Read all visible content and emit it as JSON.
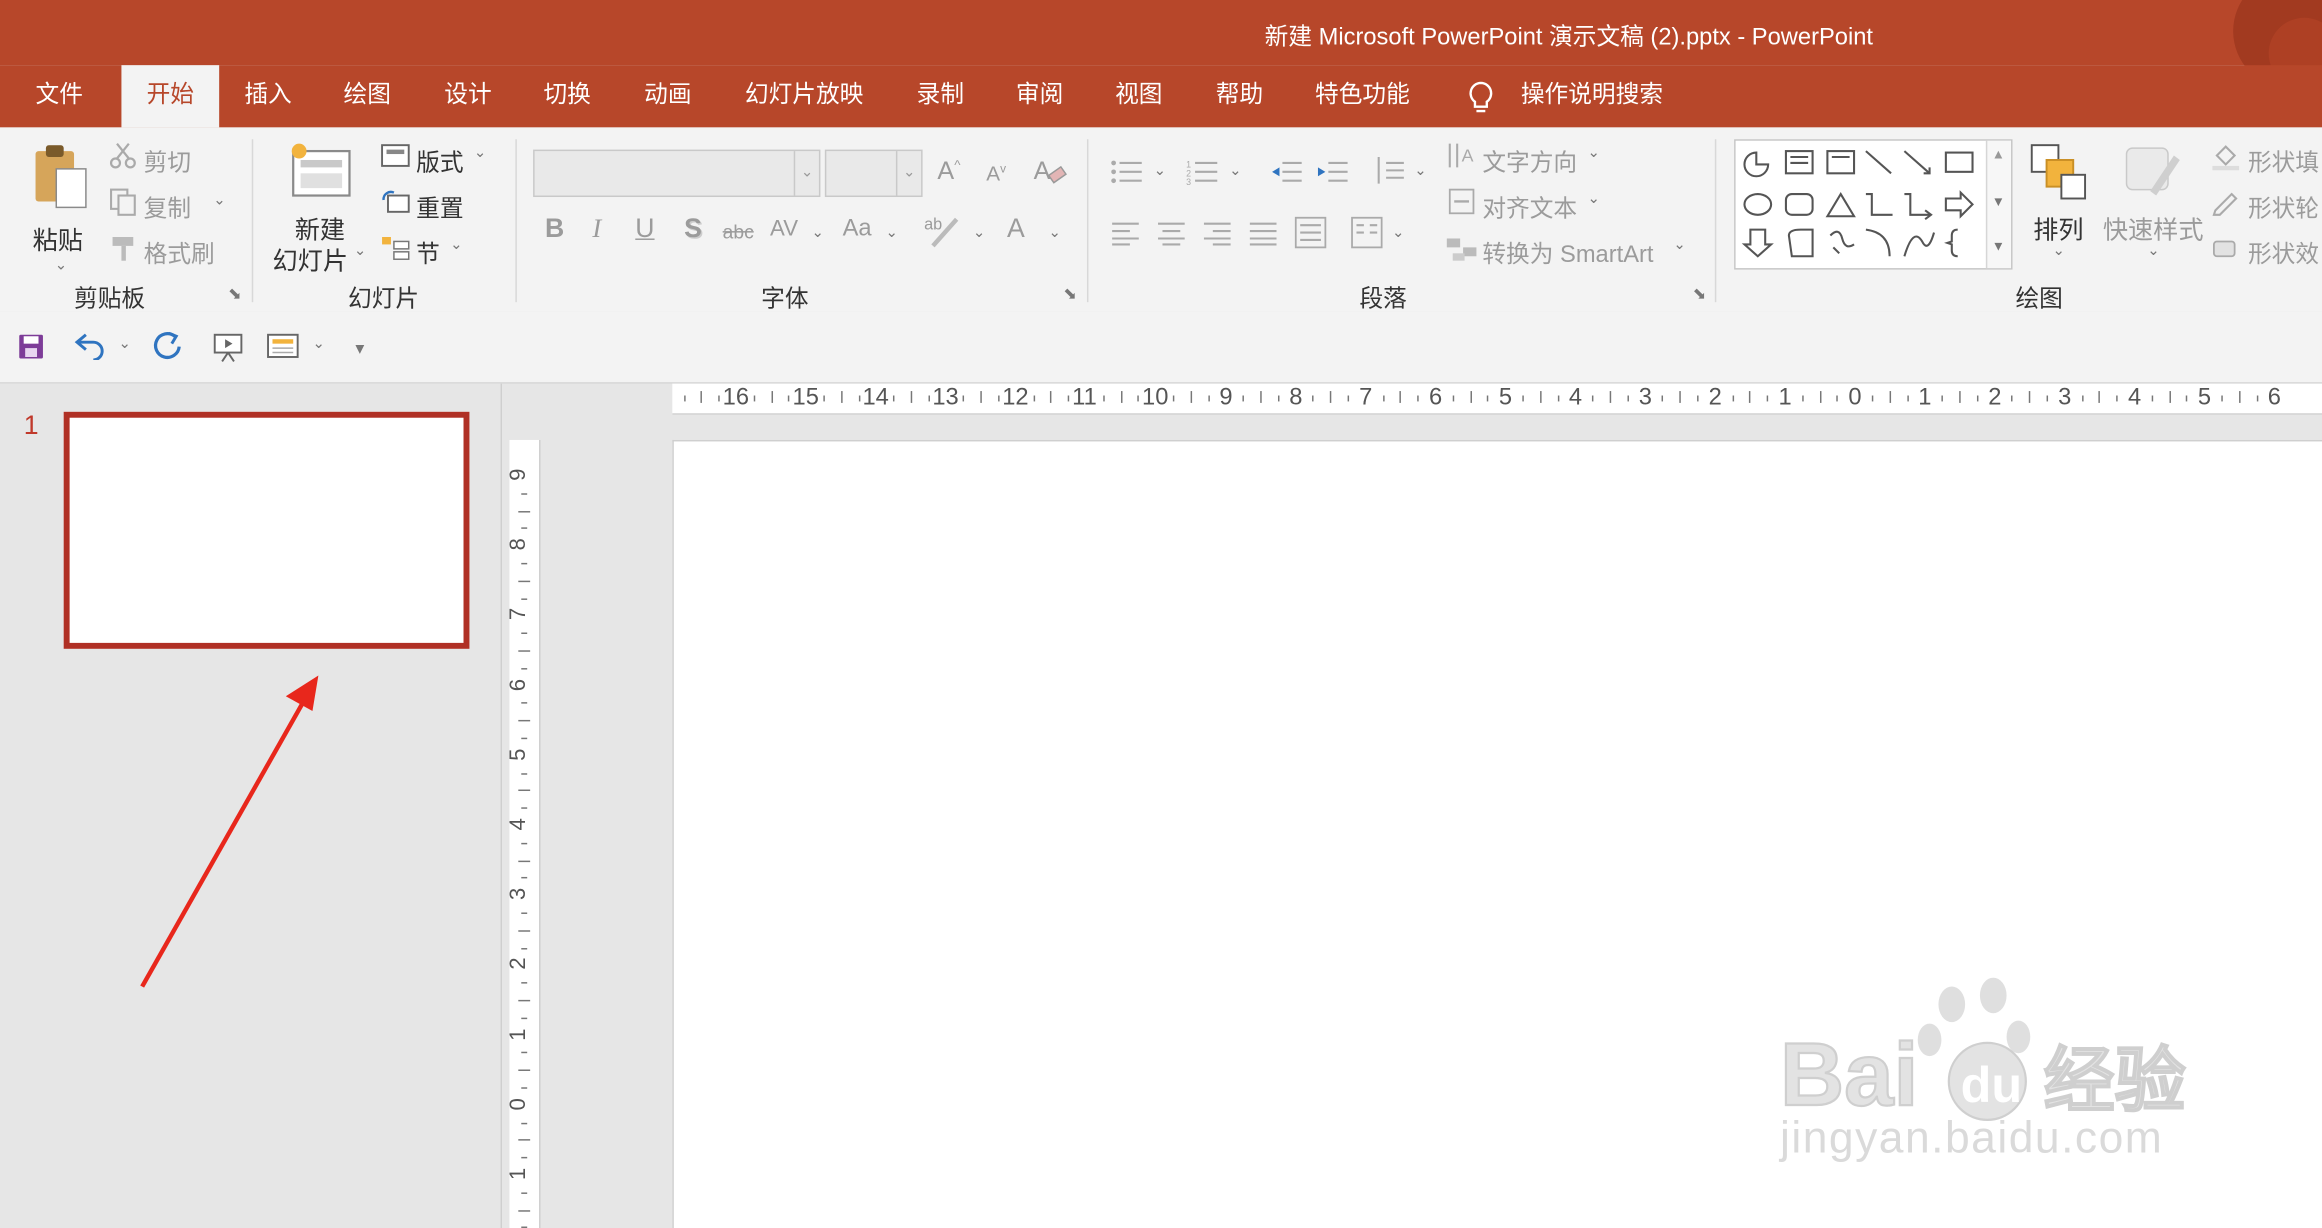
{
  "window": {
    "title": "新建 Microsoft PowerPoint 演示文稿 (2).pptx  -  PowerPoint"
  },
  "tabs": [
    {
      "label": "文件"
    },
    {
      "label": "开始"
    },
    {
      "label": "插入"
    },
    {
      "label": "绘图"
    },
    {
      "label": "设计"
    },
    {
      "label": "切换"
    },
    {
      "label": "动画"
    },
    {
      "label": "幻灯片放映"
    },
    {
      "label": "录制"
    },
    {
      "label": "审阅"
    },
    {
      "label": "视图"
    },
    {
      "label": "帮助"
    },
    {
      "label": "特色功能"
    }
  ],
  "tell_me": "操作说明搜索",
  "ribbon": {
    "clipboard": {
      "paste": "粘贴",
      "cut": "剪切",
      "copy": "复制",
      "format_painter": "格式刷",
      "label": "剪贴板"
    },
    "slides": {
      "new_slide_line1": "新建",
      "new_slide_line2": "幻灯片",
      "layout": "版式",
      "reset": "重置",
      "section": "节",
      "label": "幻灯片"
    },
    "font": {
      "font_name": "",
      "font_size": "",
      "label": "字体"
    },
    "paragraph": {
      "text_direction": "文字方向",
      "align_text": "对齐文本",
      "smartart": "转换为 SmartArt",
      "label": "段落"
    },
    "drawing": {
      "arrange": "排列",
      "quick_styles": "快速样式",
      "shape_fill": "形状填",
      "shape_outline": "形状轮",
      "shape_effects": "形状效",
      "label": "绘图"
    }
  },
  "slides_panel": {
    "slide_number": "1"
  },
  "ruler": {
    "h_ticks": [
      "16",
      "15",
      "14",
      "13",
      "12",
      "11",
      "10",
      "9",
      "8",
      "7",
      "6",
      "5",
      "4",
      "3",
      "2",
      "1",
      "0",
      "1",
      "2",
      "3",
      "4",
      "5",
      "6"
    ],
    "v_ticks": [
      "9",
      "8",
      "7",
      "6",
      "5",
      "4",
      "3",
      "2",
      "1",
      "0",
      "1"
    ]
  },
  "watermark": {
    "brand": "Baidu经验",
    "url": "jingyan.baidu.com"
  },
  "colors": {
    "accent": "#b7472a",
    "thumb_border": "#b03025",
    "annotation_arrow": "#e8271c"
  }
}
